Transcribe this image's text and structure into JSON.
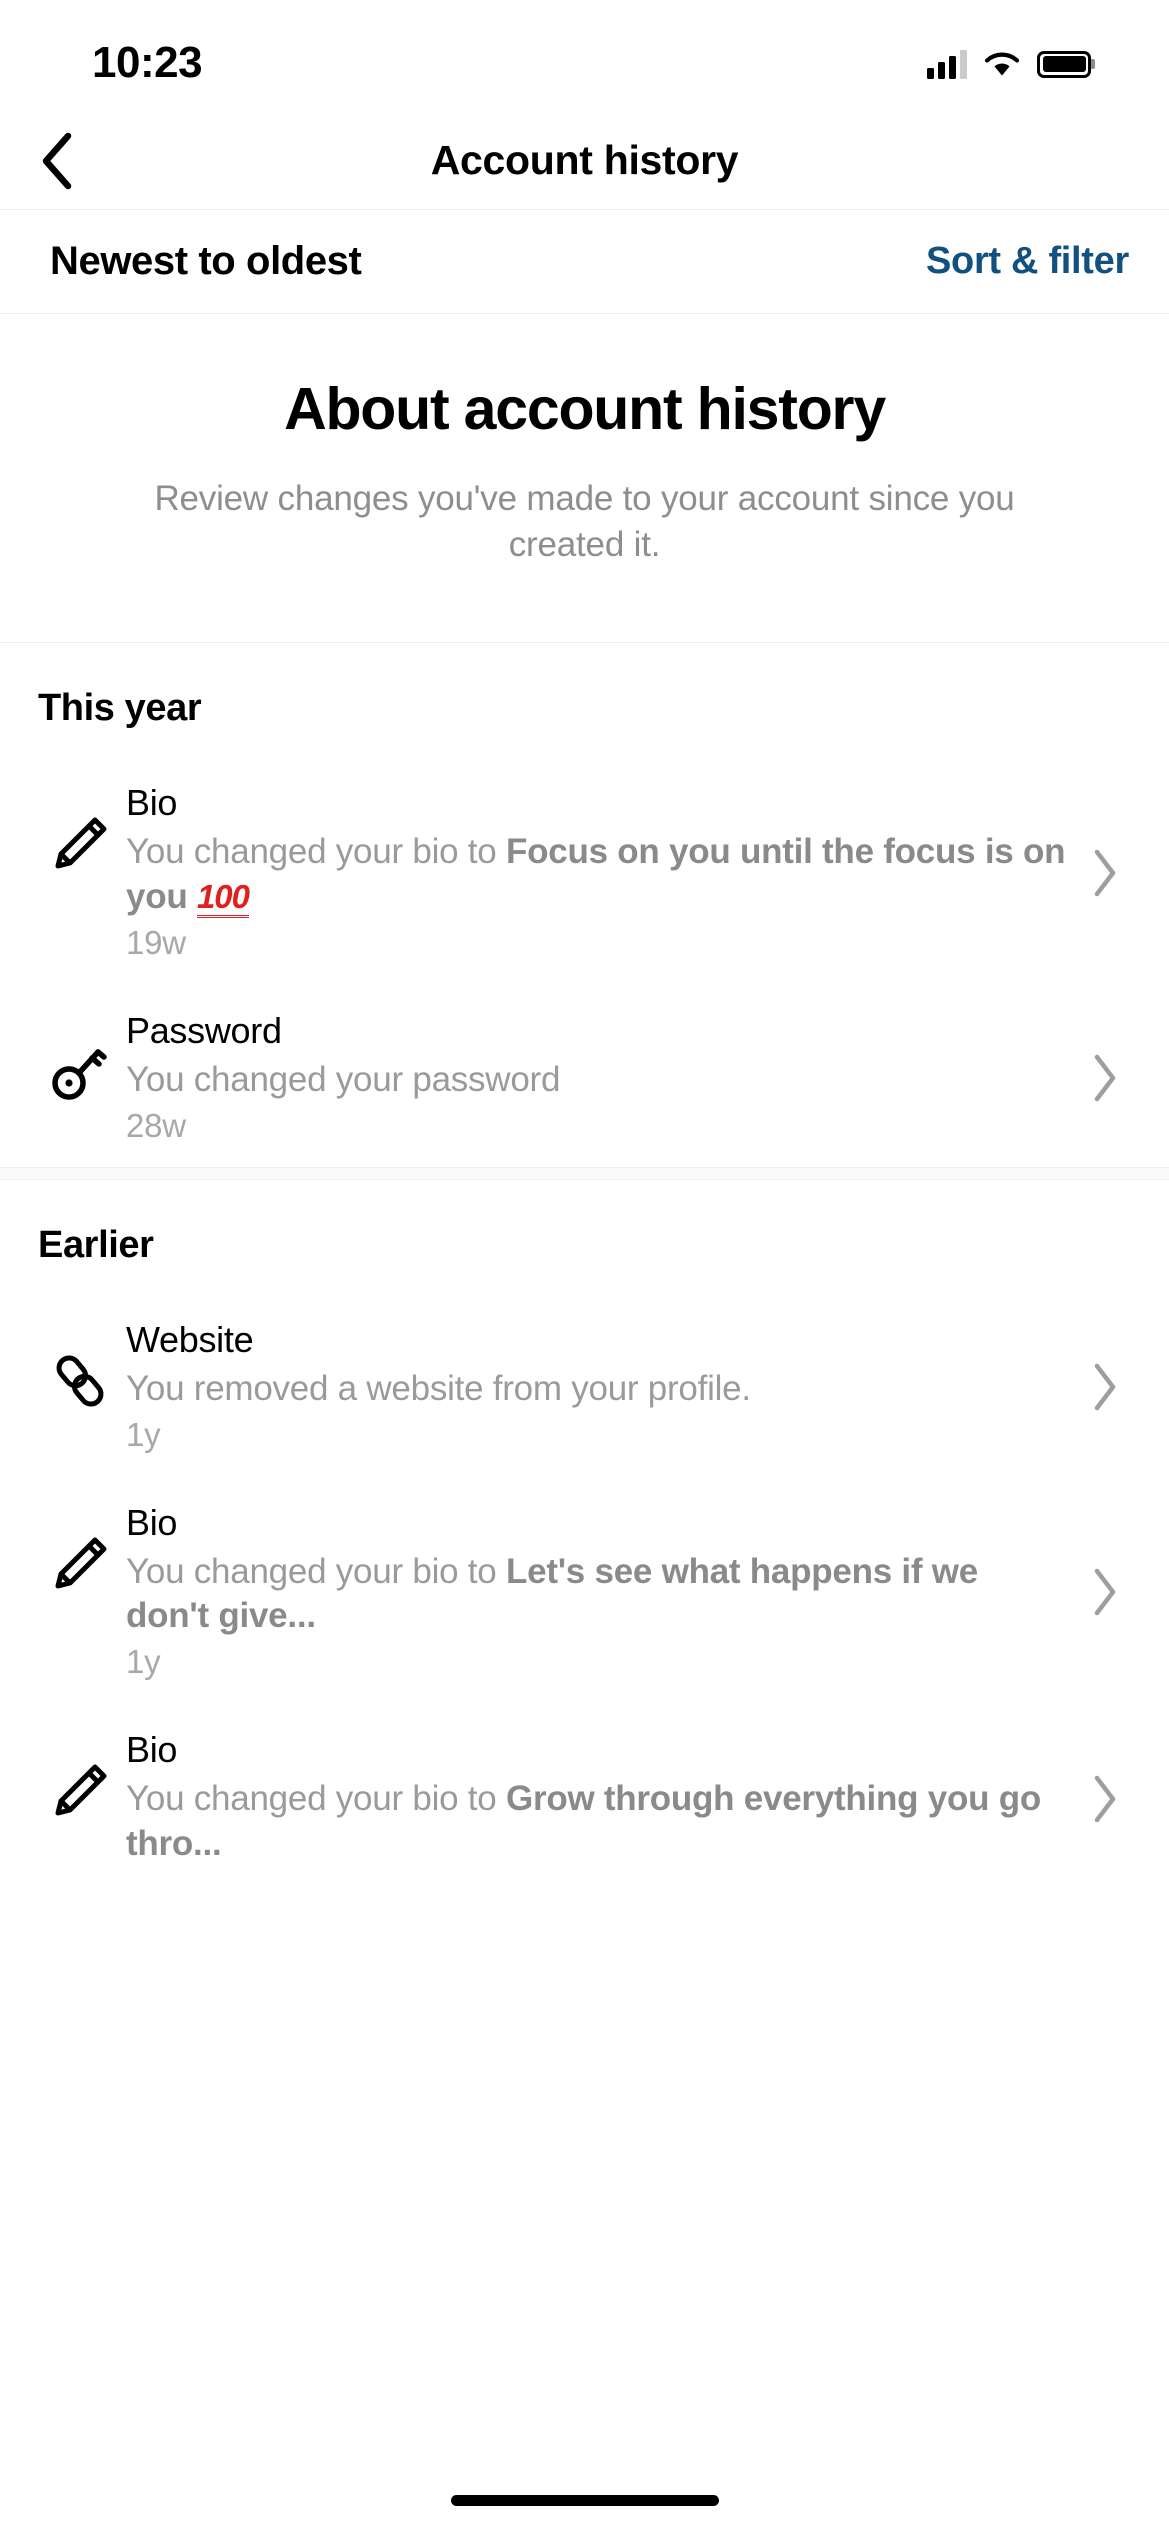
{
  "status_bar": {
    "time": "10:23",
    "signal_icon": "cellular-signal-icon",
    "wifi_icon": "wifi-icon",
    "battery_icon": "battery-icon"
  },
  "navbar": {
    "back_icon": "chevron-left-icon",
    "title": "Account history"
  },
  "sort_bar": {
    "sort_label": "Newest to oldest",
    "filter_label": "Sort & filter",
    "filter_color": "#12507f"
  },
  "about": {
    "title": "About account history",
    "subtitle": "Review changes you've made to your account since you created it."
  },
  "sections": [
    {
      "title": "This year",
      "items": [
        {
          "icon": "pencil-icon",
          "title": "Bio",
          "desc_prefix": "You changed your bio to ",
          "desc_bold": "Focus on you until the focus is on you ",
          "desc_emoji": "100",
          "time": "19w",
          "chevron": "chevron-right-icon"
        },
        {
          "icon": "key-icon",
          "title": "Password",
          "desc_prefix": "You changed your password",
          "desc_bold": "",
          "desc_emoji": "",
          "time": "28w",
          "chevron": "chevron-right-icon"
        }
      ]
    },
    {
      "title": "Earlier",
      "items": [
        {
          "icon": "link-icon",
          "title": "Website",
          "desc_prefix": "You removed a website from your profile.",
          "desc_bold": "",
          "desc_emoji": "",
          "time": "1y",
          "chevron": "chevron-right-icon"
        },
        {
          "icon": "pencil-icon",
          "title": "Bio",
          "desc_prefix": "You changed your bio to ",
          "desc_bold": "Let's see what happens if we don't give...",
          "desc_emoji": "",
          "time": "1y",
          "chevron": "chevron-right-icon"
        },
        {
          "icon": "pencil-icon",
          "title": "Bio",
          "desc_prefix": "You changed your bio to ",
          "desc_bold": "Grow through everything you go thro...",
          "desc_emoji": "",
          "time": "",
          "chevron": "chevron-right-icon"
        }
      ]
    }
  ],
  "home_indicator": "home-indicator"
}
